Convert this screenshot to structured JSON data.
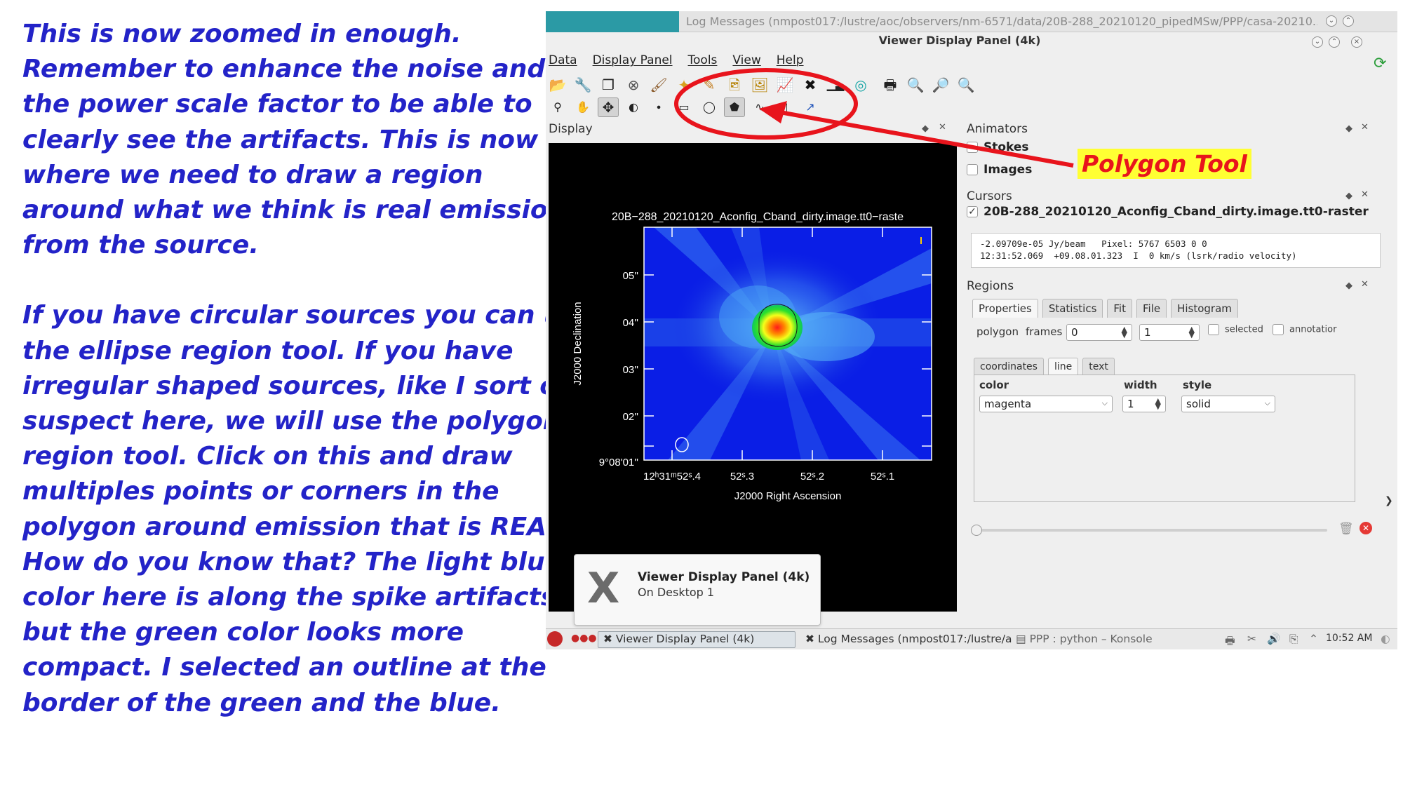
{
  "notes": {
    "paragraph1": [
      "This is now zoomed in enough.",
      "Remember to enhance the noise and",
      "the power scale factor to be able to",
      "clearly see the artifacts. This is now",
      "where we need to draw a region",
      "around what we think is real emission",
      "from the source."
    ],
    "paragraph2": [
      "If you have circular sources you can use",
      "the ellipse region tool. If you have",
      "irregular shaped sources, like I sort of",
      "suspect here, we will use the polygon",
      "region tool. Click on this and draw",
      "multiples points or corners in the",
      "polygon around emission that is REAL.",
      "How do you know that? The light blue",
      "color here is along the spike artifacts",
      "but the green color looks more",
      "compact. I selected an outline at the",
      "border of the green and the blue."
    ]
  },
  "annotation": {
    "label": "Polygon Tool",
    "color": "#e8141c",
    "highlight": "#ffff33"
  },
  "screenshot": {
    "background_window_title": "Log Messages (nmpost017:/lustre/aoc/observers/nm-6571/data/20B-288_20210120_pipedMSw/PPP/casa-20210...",
    "window_title": "Viewer Display Panel (4k)",
    "menu": [
      "Data",
      "Display Panel",
      "Tools",
      "View",
      "Help"
    ],
    "toolbar1_icons": [
      "open-folder-icon",
      "wrench-icon",
      "copy-icon",
      "close-circle-icon",
      "brush-icon",
      "star-paint-icon",
      "adjust-icon",
      "image-save-icon",
      "image-icon",
      "chart-icon",
      "fit-icon",
      "histogram-icon",
      "target-icon",
      "print-icon",
      "zoom-icon",
      "zoom-in-icon",
      "zoom-out-icon"
    ],
    "toolbar2_icons": [
      "zoom-tool-icon",
      "pan-hand-icon",
      "move-icon",
      "contrast-icon",
      "point-tool-icon",
      "rectangle-tool-icon",
      "ellipse-tool-icon",
      "polygon-tool-icon",
      "polyline-tool-icon",
      "ruler-tool-icon",
      "position-tool-icon"
    ],
    "display": {
      "title": "Display",
      "image_title": "20B−288_20210120_Aconfig_Cband_dirty.image.tt0−raste",
      "y_axis_label": "J2000 Declination",
      "x_axis_label": "J2000 Right Ascension",
      "y_ticks": [
        "05''",
        "04''",
        "03''",
        "02''",
        "9°08'01''"
      ],
      "x_ticks": [
        "12ʰ31ᵐ52ˢ.4",
        "52ˢ.3",
        "52ˢ.2",
        "52ˢ.1"
      ]
    },
    "animators": {
      "title": "Animators",
      "items": [
        "Stokes",
        "Images"
      ]
    },
    "cursors": {
      "title": "Cursors",
      "image_name": "20B-288_20210120_Aconfig_Cband_dirty.image.tt0-raster",
      "line1": "-2.09709e-05 Jy/beam   Pixel: 5767 6503 0 0",
      "line2": "12:31:52.069  +09.08.01.323  I  0 km/s (lsrk/radio velocity)"
    },
    "regions": {
      "title": "Regions",
      "tabs": [
        "Properties",
        "Statistics",
        "Fit",
        "File",
        "Histogram"
      ],
      "shape_label": "polygon",
      "frames_label": "frames",
      "frame_from": "0",
      "frame_to": "1",
      "selected_label": "selected",
      "annotation_label": "annotatior",
      "subtabs": [
        "coordinates",
        "line",
        "text"
      ],
      "color_header": "color",
      "width_header": "width",
      "style_header": "style",
      "color_value": "magenta",
      "width_value": "1",
      "style_value": "solid"
    },
    "notification": {
      "title": "Viewer Display Panel (4k)",
      "subtitle": "On Desktop 1"
    },
    "taskbar": {
      "items": [
        "Viewer Display Panel (4k)",
        "Log Messages (nmpost017:/lustre/a",
        "PPP : python – Konsole"
      ],
      "clock": "10:52 AM"
    }
  }
}
